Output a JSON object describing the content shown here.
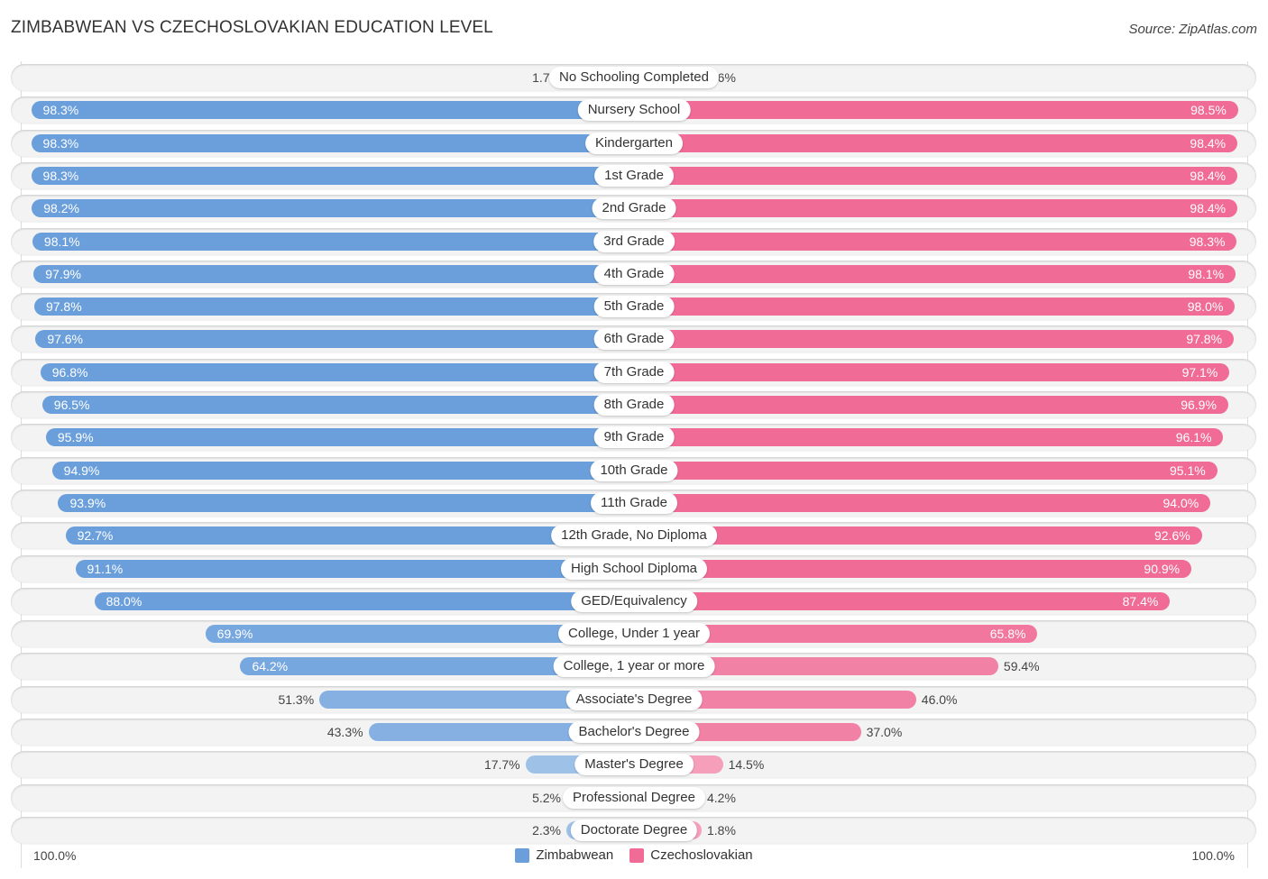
{
  "header": {
    "title": "ZIMBABWEAN VS CZECHOSLOVAKIAN EDUCATION LEVEL",
    "source": "Source: ZipAtlas.com"
  },
  "axis": {
    "left_label": "100.0%",
    "right_label": "100.0%"
  },
  "legend": [
    {
      "name": "Zimbabwean",
      "color": "#6a9fdb"
    },
    {
      "name": "Czechoslovakian",
      "color": "#f06b96"
    }
  ],
  "chart_data": {
    "type": "bar",
    "orientation": "horizontal-diverging",
    "title": "ZIMBABWEAN VS CZECHOSLOVAKIAN EDUCATION LEVEL",
    "xlabel": "",
    "ylabel": "",
    "xlim": [
      0,
      100
    ],
    "unit": "%",
    "legend_position": "bottom-center",
    "categories": [
      "No Schooling Completed",
      "Nursery School",
      "Kindergarten",
      "1st Grade",
      "2nd Grade",
      "3rd Grade",
      "4th Grade",
      "5th Grade",
      "6th Grade",
      "7th Grade",
      "8th Grade",
      "9th Grade",
      "10th Grade",
      "11th Grade",
      "12th Grade, No Diploma",
      "High School Diploma",
      "GED/Equivalency",
      "College, Under 1 year",
      "College, 1 year or more",
      "Associate's Degree",
      "Bachelor's Degree",
      "Master's Degree",
      "Professional Degree",
      "Doctorate Degree"
    ],
    "series": [
      {
        "name": "Zimbabwean",
        "color": "#6a9fdb",
        "side": "left",
        "values": [
          1.7,
          98.3,
          98.3,
          98.3,
          98.2,
          98.1,
          97.9,
          97.8,
          97.6,
          96.8,
          96.5,
          95.9,
          94.9,
          93.9,
          92.7,
          91.1,
          88.0,
          69.9,
          64.2,
          51.3,
          43.3,
          17.7,
          5.2,
          2.3
        ],
        "labels": [
          "1.7%",
          "98.3%",
          "98.3%",
          "98.3%",
          "98.2%",
          "98.1%",
          "97.9%",
          "97.8%",
          "97.6%",
          "96.8%",
          "96.5%",
          "95.9%",
          "94.9%",
          "93.9%",
          "92.7%",
          "91.1%",
          "88.0%",
          "69.9%",
          "64.2%",
          "51.3%",
          "43.3%",
          "17.7%",
          "5.2%",
          "2.3%"
        ]
      },
      {
        "name": "Czechoslovakian",
        "color": "#f06b96",
        "side": "right",
        "values": [
          1.6,
          98.5,
          98.4,
          98.4,
          98.4,
          98.3,
          98.1,
          98.0,
          97.8,
          97.1,
          96.9,
          96.1,
          95.1,
          94.0,
          92.6,
          90.9,
          87.4,
          65.8,
          59.4,
          46.0,
          37.0,
          14.5,
          4.2,
          1.8
        ],
        "labels": [
          "1.6%",
          "98.5%",
          "98.4%",
          "98.4%",
          "98.4%",
          "98.3%",
          "98.1%",
          "98.0%",
          "97.8%",
          "97.1%",
          "96.9%",
          "96.1%",
          "95.1%",
          "94.0%",
          "92.6%",
          "90.9%",
          "87.4%",
          "65.8%",
          "59.4%",
          "46.0%",
          "37.0%",
          "14.5%",
          "4.2%",
          "1.8%"
        ]
      }
    ]
  }
}
